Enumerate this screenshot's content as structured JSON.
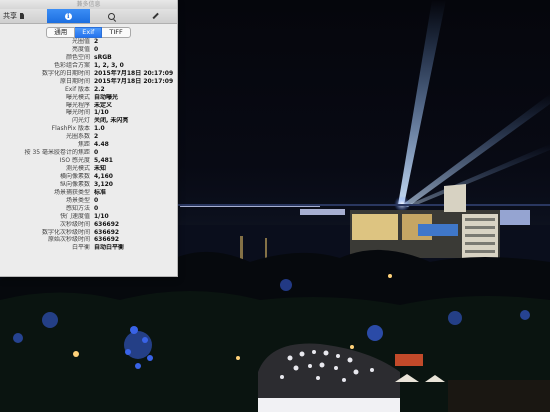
{
  "window": {
    "title": "兼多信息"
  },
  "toolbar": {
    "share_label": "共享"
  },
  "tabs": {
    "general": "通用",
    "exif": "Exif",
    "tiff": "TIFF",
    "selected": "Exif"
  },
  "exif_rows": [
    {
      "key": "光圈值",
      "value": "2"
    },
    {
      "key": "亮度值",
      "value": "0"
    },
    {
      "key": "颜色空间",
      "value": "sRGB"
    },
    {
      "key": "色彩组合方案",
      "value": "1, 2, 3, 0"
    },
    {
      "key": "数字化的日期时间",
      "value": "2015年7月18日 20:17:09"
    },
    {
      "key": "原日期时间",
      "value": "2015年7月18日 20:17:09"
    },
    {
      "key": "Exif 版本",
      "value": "2.2"
    },
    {
      "key": "曝光模式",
      "value": "自动曝光"
    },
    {
      "key": "曝光程序",
      "value": "未定义"
    },
    {
      "key": "曝光时间",
      "value": "1/10"
    },
    {
      "key": "闪光灯",
      "value": "关闭, 未闪亮"
    },
    {
      "key": "FlashPix 版本",
      "value": "1.0"
    },
    {
      "key": "光圈系数",
      "value": "2"
    },
    {
      "key": "焦距",
      "value": "4.48"
    },
    {
      "key": "按 35 毫米胶卷计的焦距",
      "value": "0"
    },
    {
      "key": "ISO 感光度",
      "value": "5,481"
    },
    {
      "key": "测光模式",
      "value": "未知"
    },
    {
      "key": "横向像素数",
      "value": "4,160"
    },
    {
      "key": "纵向像素数",
      "value": "3,120"
    },
    {
      "key": "场景捕获类型",
      "value": "标准"
    },
    {
      "key": "场景类型",
      "value": "0"
    },
    {
      "key": "感知方法",
      "value": "0"
    },
    {
      "key": "快门速度值",
      "value": "1/10"
    },
    {
      "key": "次秒级时间",
      "value": "636692"
    },
    {
      "key": "数字化次秒级时间",
      "value": "636692"
    },
    {
      "key": "原始次秒级时间",
      "value": "636692"
    },
    {
      "key": "白平衡",
      "value": "自动白平衡"
    }
  ],
  "colors": {
    "accent": "#1d6fe0",
    "panel_bg": "#ececec"
  }
}
